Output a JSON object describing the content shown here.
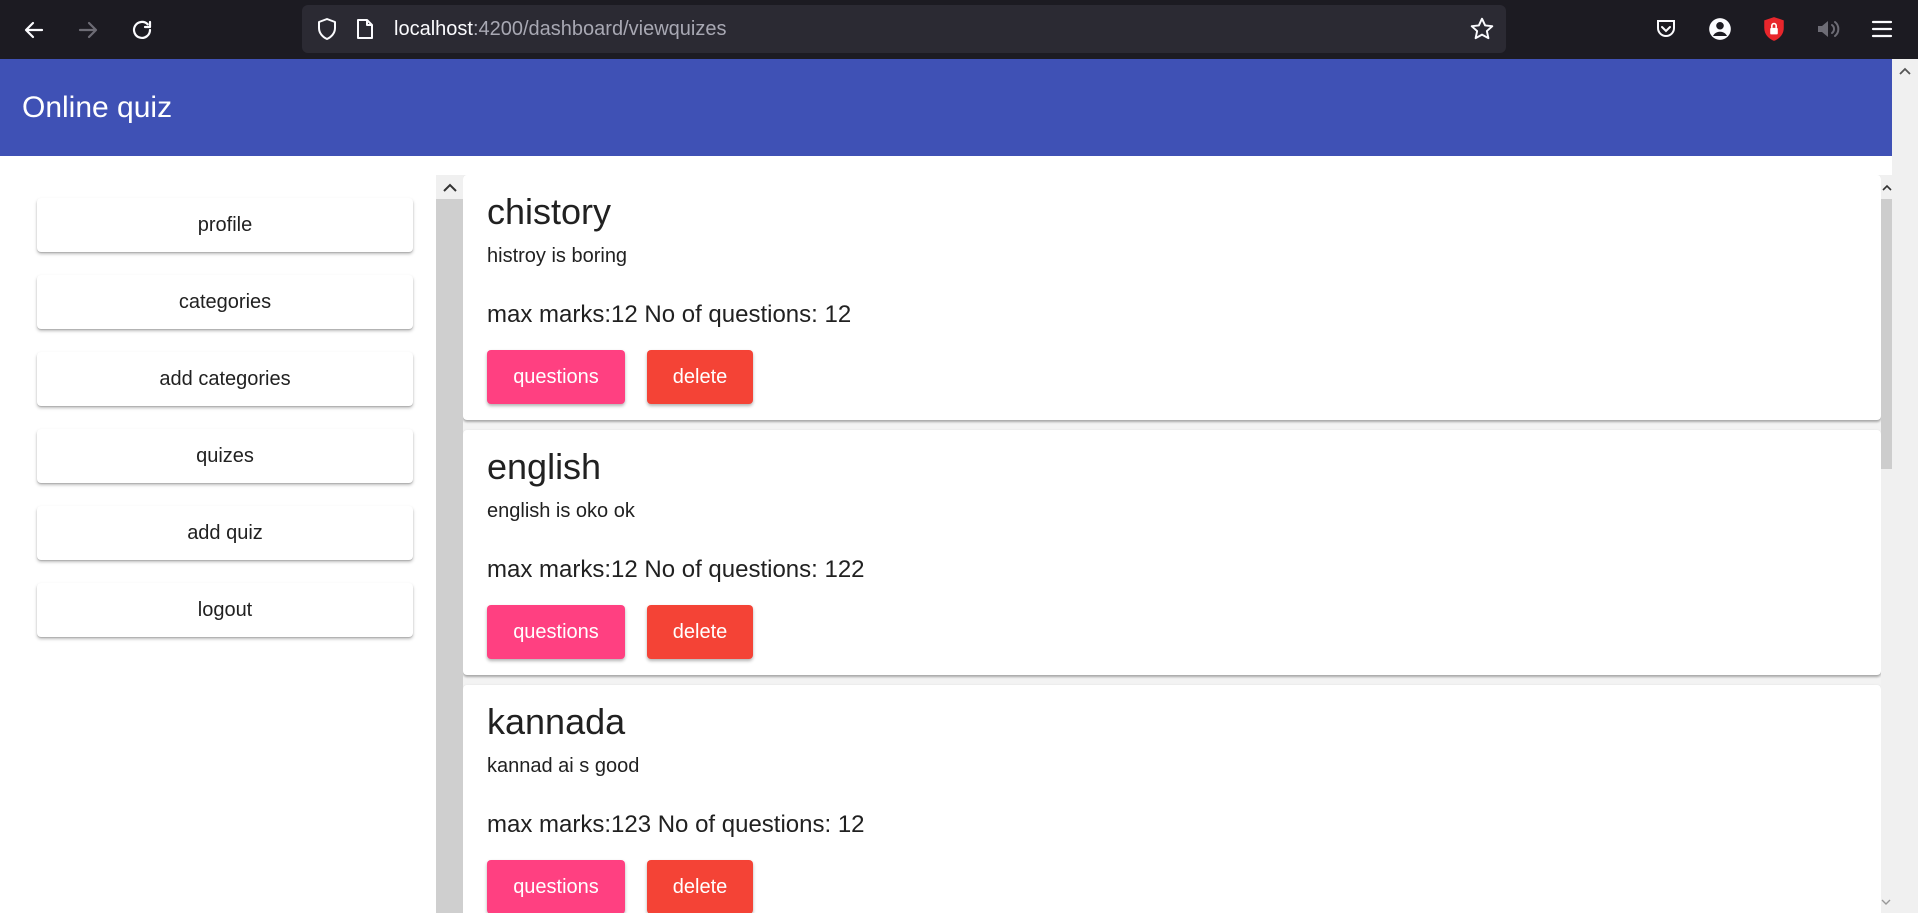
{
  "browser": {
    "url_host": "localhost",
    "url_path": ":4200/dashboard/viewquizes",
    "icons": [
      "back-arrow-icon",
      "forward-arrow-icon",
      "reload-icon",
      "shield-icon",
      "page-icon",
      "star-icon",
      "pocket-icon",
      "account-icon",
      "extension-shield-icon",
      "speaker-icon",
      "menu-icon"
    ]
  },
  "header": {
    "title": "Online quiz"
  },
  "sidebar": {
    "items": [
      {
        "label": "profile"
      },
      {
        "label": "categories"
      },
      {
        "label": "add categories"
      },
      {
        "label": "quizes"
      },
      {
        "label": "add quiz"
      },
      {
        "label": "logout"
      }
    ]
  },
  "quizzes": [
    {
      "title": "chistory",
      "description": "histroy is boring",
      "meta": "max marks:12 No of questions: 12",
      "questions_label": "questions",
      "delete_label": "delete"
    },
    {
      "title": "english",
      "description": "english is oko ok",
      "meta": "max marks:12 No of questions: 122",
      "questions_label": "questions",
      "delete_label": "delete"
    },
    {
      "title": "kannada",
      "description": "kannad ai s good",
      "meta": "max marks:123 No of questions: 12",
      "questions_label": "questions",
      "delete_label": "delete"
    }
  ],
  "colors": {
    "header": "#3f51b5",
    "accent": "#ff4081",
    "warn": "#f44336",
    "chrome": "#1c1b22"
  }
}
